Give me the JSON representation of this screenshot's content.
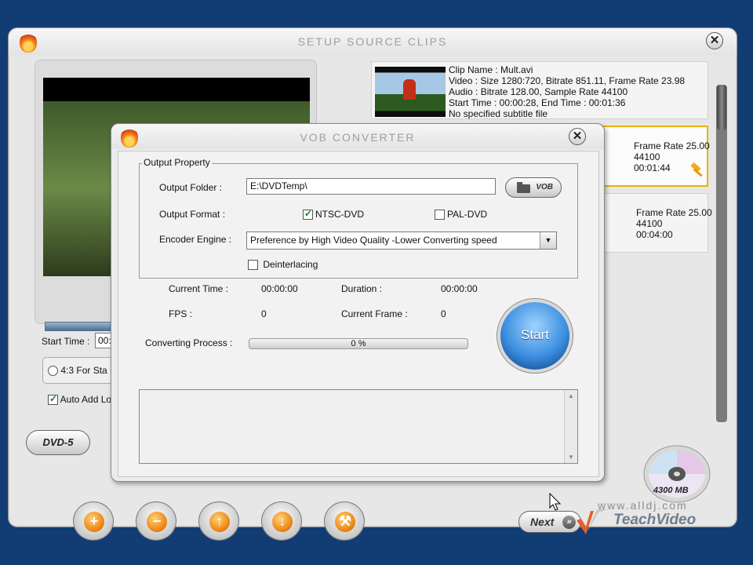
{
  "main_window": {
    "title": "SETUP SOURCE CLIPS",
    "close_label": "✕",
    "start_time_label": "Start Time :",
    "start_time_value": "00:",
    "aspect_option": "4:3 For Sta",
    "auto_add_label": "Auto Add Lo",
    "dvd_badge": "DVD-5",
    "disc_capacity": "4300 MB",
    "next_label": "Next"
  },
  "clips": [
    {
      "name_line": "Clip Name : Mult.avi",
      "video_line": "Video : Size 1280:720, Bitrate 851.11, Frame Rate 23.98",
      "audio_line": "Audio : Bitrate 128.00, Sample Rate 44100",
      "time_line": "Start Time : 00:00:28, End Time : 00:01:36",
      "subtitle_line": "No specified subtitle file"
    },
    {
      "line1": "Frame Rate 25.00",
      "line2": "44100",
      "line3": "00:01:44"
    },
    {
      "line1": "Frame Rate 25.00",
      "line2": "44100",
      "line3": "00:04:00"
    }
  ],
  "dialog": {
    "title": "VOB CONVERTER",
    "close_label": "✕",
    "group_title": "Output Property",
    "output_folder_label": "Output Folder :",
    "output_folder_value": "E:\\DVDTemp\\",
    "vob_button_label": "VOB",
    "output_format_label": "Output Format :",
    "format_ntsc": "NTSC-DVD",
    "format_pal": "PAL-DVD",
    "encoder_label": "Encoder Engine :",
    "encoder_value": "Preference by High Video Quality -Lower Converting speed",
    "deinterlacing_label": "Deinterlacing",
    "current_time_label": "Current Time :",
    "current_time_value": "00:00:00",
    "duration_label": "Duration :",
    "duration_value": "00:00:00",
    "fps_label": "FPS :",
    "fps_value": "0",
    "current_frame_label": "Current Frame :",
    "current_frame_value": "0",
    "process_label": "Converting Process :",
    "progress_text": "0 %",
    "progress_fraction": 0,
    "start_label": "Start"
  },
  "watermark": {
    "url": "www.alldj.com",
    "brand": "TeachVideo"
  },
  "colors": {
    "background": "#123c74",
    "start_button": "#3d8fe0",
    "selected_clip_border": "#e6b400"
  },
  "icons": [
    "flame-icon",
    "close-icon",
    "folder-icon",
    "checkbox-icon",
    "dropdown-arrow-icon",
    "add-icon",
    "remove-icon",
    "move-up-icon",
    "move-down-icon",
    "settings-icon",
    "next-arrow-icon",
    "disc-icon",
    "hammer-icon"
  ]
}
